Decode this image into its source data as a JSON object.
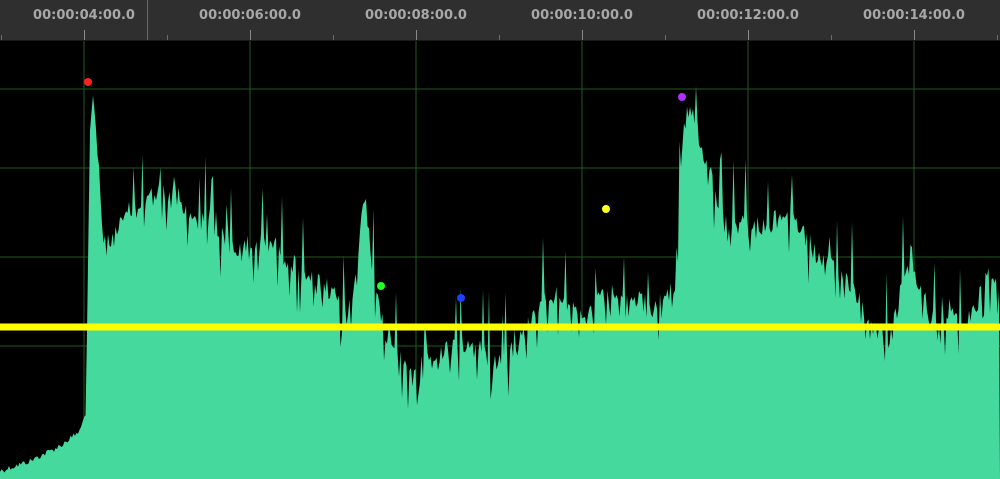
{
  "ruler": {
    "ticks": [
      {
        "label": "00:00:04:00.0"
      },
      {
        "label": "00:00:06:00.0"
      },
      {
        "label": "00:00:08:00.0"
      },
      {
        "label": "00:00:10:00.0"
      },
      {
        "label": "00:00:12:00.0"
      },
      {
        "label": "00:00:14:00.0"
      }
    ]
  },
  "waveform": {
    "fill_color": "#45d99d",
    "grid_color": "#1f5a1f",
    "threshold_color": "#ffff00"
  },
  "markers": [
    {
      "name": "red",
      "color": "#ff2020"
    },
    {
      "name": "green",
      "color": "#22ff22"
    },
    {
      "name": "blue",
      "color": "#2040ff"
    },
    {
      "name": "yellow",
      "color": "#ffff22"
    },
    {
      "name": "purple",
      "color": "#b030ff"
    }
  ]
}
